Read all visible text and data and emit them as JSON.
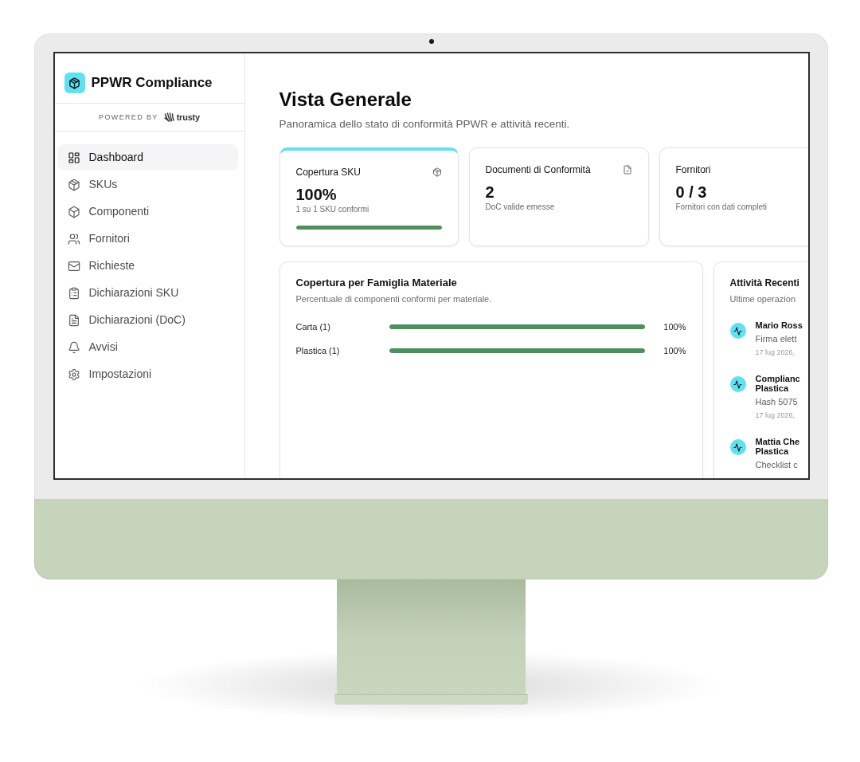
{
  "sidebar": {
    "app_title": "PPWR Compliance",
    "powered_by": "POWERED BY",
    "brand": "trusty",
    "items": [
      {
        "label": "Dashboard",
        "selected": true
      },
      {
        "label": "SKUs",
        "selected": false
      },
      {
        "label": "Componenti",
        "selected": false
      },
      {
        "label": "Fornitori",
        "selected": false
      },
      {
        "label": "Richieste",
        "selected": false
      },
      {
        "label": "Dichiarazioni SKU",
        "selected": false
      },
      {
        "label": "Dichiarazioni (DoC)",
        "selected": false
      },
      {
        "label": "Avvisi",
        "selected": false
      },
      {
        "label": "Impostazioni",
        "selected": false
      }
    ]
  },
  "header": {
    "title": "Vista Generale",
    "subtitle": "Panoramica dello stato di conformità PPWR e attività recenti."
  },
  "stat_cards": [
    {
      "title": "Copertura SKU",
      "value": "100%",
      "caption": "1 su 1 SKU conformi",
      "highlighted": true,
      "level": 1
    },
    {
      "title": "Documenti di Conformità",
      "value": "2",
      "caption": "DoC valide emesse",
      "highlighted": false
    },
    {
      "title": "Fornitori",
      "value": "0 / 3",
      "caption": "Fornitori con dati completi",
      "highlighted": false
    }
  ],
  "material_coverage": {
    "title": "Copertura per Famiglia Materiale",
    "subtitle": "Percentuale di componenti conformi per materiale.",
    "rows": [
      {
        "label": "Carta (1)",
        "level": 1,
        "reading": "100%"
      },
      {
        "label": "Plastica (1)",
        "level": 1,
        "reading": "100%"
      }
    ]
  },
  "recent_activity": {
    "title": "Attività Recenti",
    "subtitle": "Ultime operazion",
    "items": [
      {
        "title_lines": [
          "Mario Ross"
        ],
        "detail": "Firma elett",
        "time": "17 lug 2026,"
      },
      {
        "title_lines": [
          "Complianc",
          "Plastica"
        ],
        "detail": "Hash 5075",
        "time": "17 lug 2026,"
      },
      {
        "title_lines": [
          "Mattia Che",
          "Plastica"
        ],
        "detail": "Checklist c"
      }
    ]
  }
}
